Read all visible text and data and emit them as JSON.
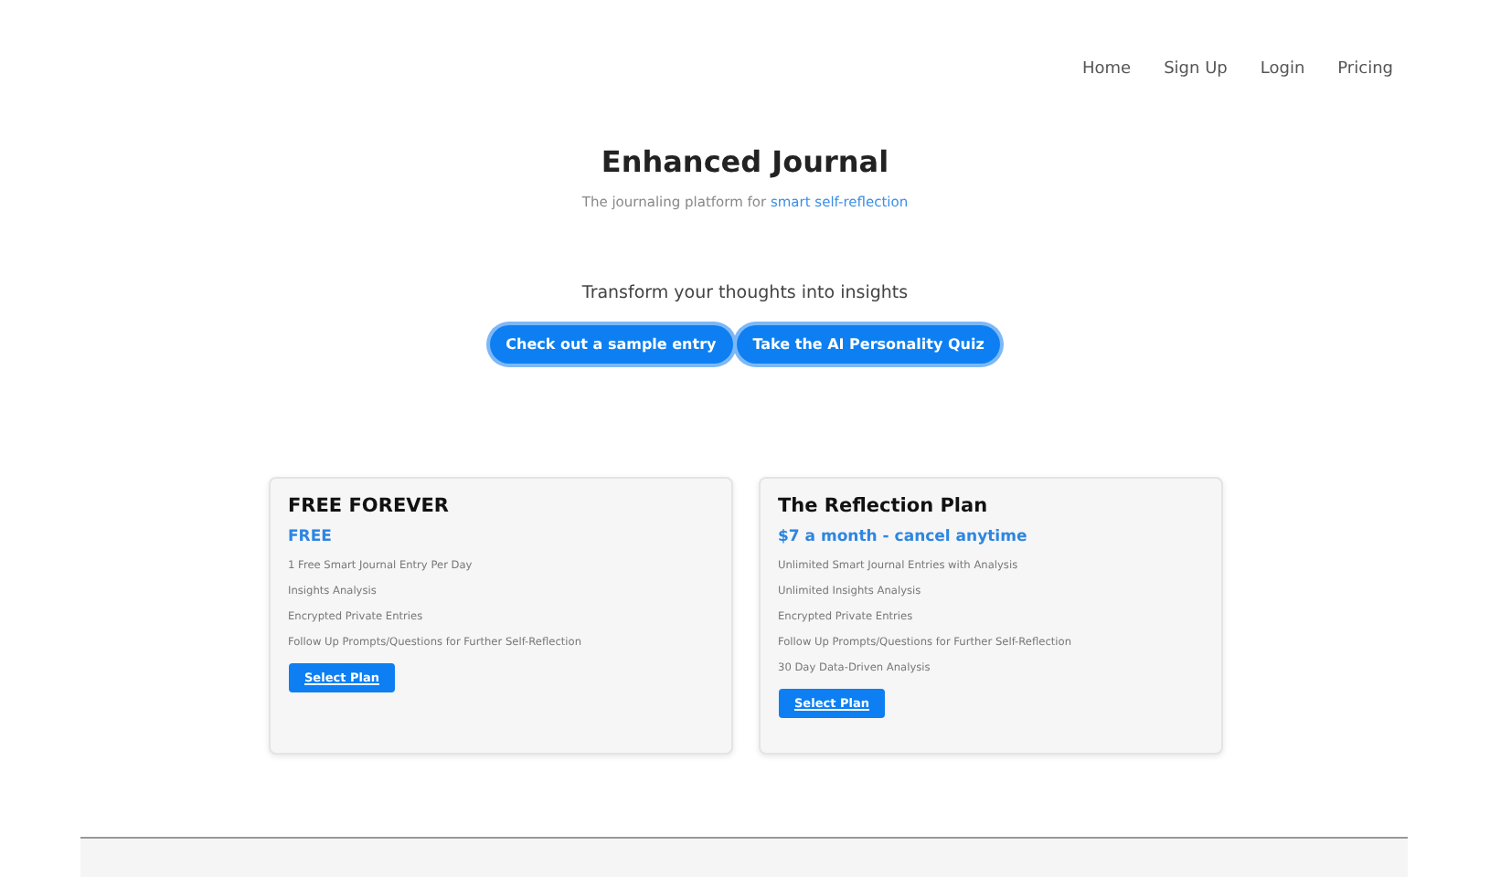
{
  "nav": [
    {
      "label": "Home"
    },
    {
      "label": "Sign Up"
    },
    {
      "label": "Login"
    },
    {
      "label": "Pricing"
    }
  ],
  "hero": {
    "title": "Enhanced Journal",
    "tagline": "The journaling platform for",
    "tagline_link": "smart self-reflection",
    "subtitle": "Transform your thoughts into insights",
    "buttons": [
      "Check out a sample entry",
      "Take the AI Personality Quiz"
    ]
  },
  "plans": [
    {
      "name": "FREE FOREVER",
      "price": "FREE",
      "features": [
        "1 Free Smart Journal Entry Per Day",
        "Insights Analysis",
        "Encrypted Private Entries",
        "Follow Up Prompts/Questions for Further Self-Reflection"
      ],
      "button": "Select Plan"
    },
    {
      "name": "The Reflection Plan",
      "price": "$7 a month - cancel anytime",
      "features": [
        "Unlimited Smart Journal Entries with Analysis",
        "Unlimited Insights Analysis",
        "Encrypted Private Entries",
        "Follow Up Prompts/Questions for Further Self-Reflection",
        "30 Day Data-Driven Analysis"
      ],
      "button": "Select Plan"
    }
  ]
}
